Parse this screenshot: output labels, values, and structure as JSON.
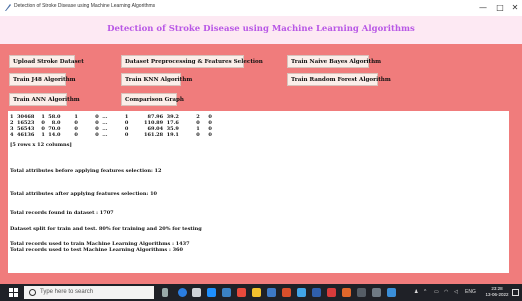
{
  "window": {
    "title": "Detection of Stroke Disease using Machine Learning Algorithms",
    "minimize": "—",
    "maximize": "□",
    "close": "✕"
  },
  "header": {
    "heading": "Detection of Stroke Disease using Machine Learning Algorithms"
  },
  "buttons": {
    "upload": "Upload Stroke Dataset",
    "preprocess": "Dataset Preprocessing & Features Selection",
    "naive_bayes": "Train Naive Bayes Algorithm",
    "j48": "Train J48 Algorithm",
    "knn": "Train KNN Algorithm",
    "random_forest": "Train Random Forest Algorithm",
    "ann": "Train ANN Algorithm",
    "comparison": "Comparison Graph"
  },
  "output": {
    "rows": [
      "1  30468    1  58.0        1          0  ...          1           87.96  39.2          2     0",
      "2  16523    0    8.0        0          0  ...          0         110.89  17.6          0     0",
      "3  56543    0  70.0        0          0  ...          0           69.04  35.9          1     0",
      "4  46136    1  14.0        0          0  ...          0         161.28  19.1          0     0"
    ],
    "shape": "[5 rows x 12 columns]",
    "attr_before": "Total attributes before applying features selection: 12",
    "attr_after": "Total attributes after applying features selection: 10",
    "total_records": "Total records found in dataset : 1707",
    "split": "Dataset split for train and test. 80% for training and 20% for testing",
    "train_records": "Total records used to train Machine Learning Algorithms : 1437",
    "test_records": "Total records used to test Machine Learning Algorithms : 360"
  },
  "taskbar": {
    "search_placeholder": "Type here to search",
    "time": "23:28",
    "date": "13-06-2022",
    "language": "ENG"
  },
  "colors": {
    "background": "#f07c7c",
    "header_bg": "#fde9f3",
    "heading": "#b857e6"
  }
}
